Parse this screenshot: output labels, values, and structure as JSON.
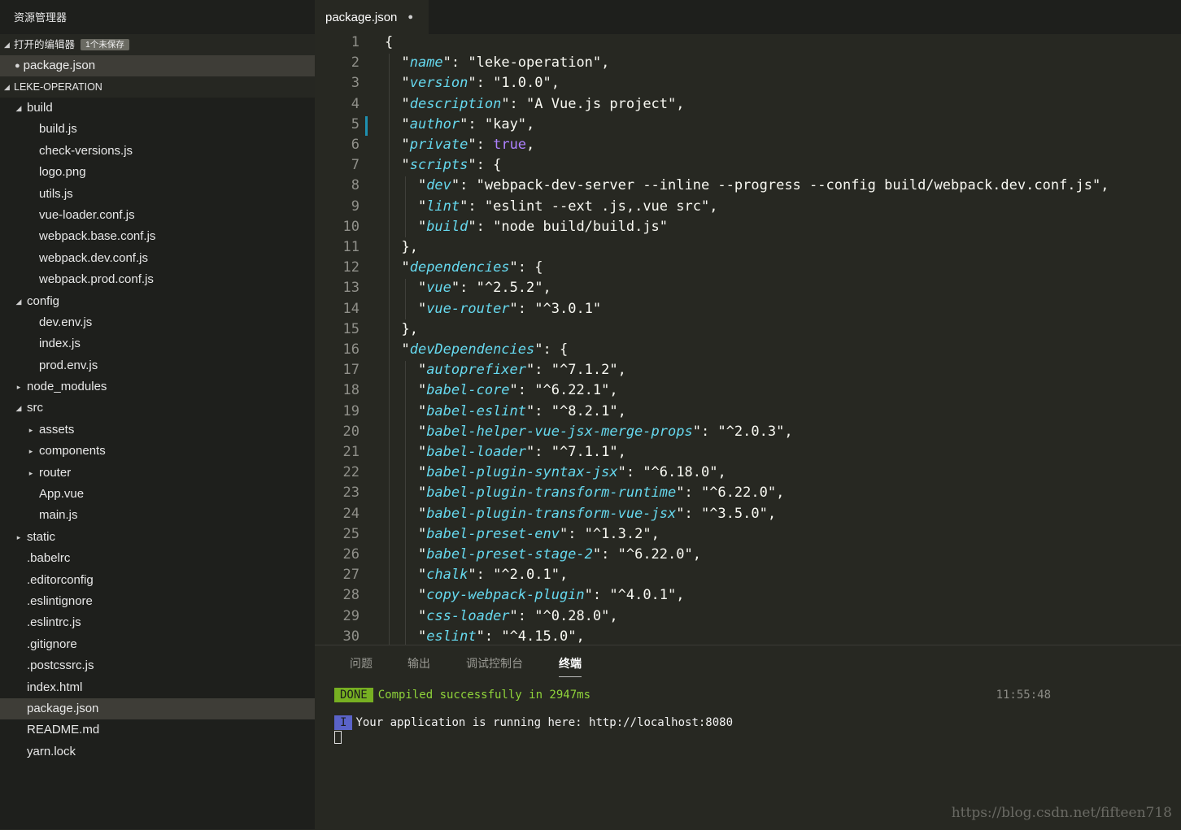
{
  "sidebar": {
    "title": "资源管理器",
    "open_editors": {
      "header": "打开的编辑器",
      "badge": "1个未保存",
      "items": [
        {
          "dirty": "●",
          "label": "package.json"
        }
      ]
    },
    "project": {
      "header": "LEKE-OPERATION",
      "tree": [
        {
          "label": "build",
          "depth": 0,
          "type": "folder-open",
          "twisty": "◢"
        },
        {
          "label": "build.js",
          "depth": 1,
          "type": "file"
        },
        {
          "label": "check-versions.js",
          "depth": 1,
          "type": "file"
        },
        {
          "label": "logo.png",
          "depth": 1,
          "type": "file"
        },
        {
          "label": "utils.js",
          "depth": 1,
          "type": "file"
        },
        {
          "label": "vue-loader.conf.js",
          "depth": 1,
          "type": "file"
        },
        {
          "label": "webpack.base.conf.js",
          "depth": 1,
          "type": "file"
        },
        {
          "label": "webpack.dev.conf.js",
          "depth": 1,
          "type": "file"
        },
        {
          "label": "webpack.prod.conf.js",
          "depth": 1,
          "type": "file"
        },
        {
          "label": "config",
          "depth": 0,
          "type": "folder-open",
          "twisty": "◢"
        },
        {
          "label": "dev.env.js",
          "depth": 1,
          "type": "file"
        },
        {
          "label": "index.js",
          "depth": 1,
          "type": "file"
        },
        {
          "label": "prod.env.js",
          "depth": 1,
          "type": "file"
        },
        {
          "label": "node_modules",
          "depth": 0,
          "type": "folder-closed",
          "twisty": "▸"
        },
        {
          "label": "src",
          "depth": 0,
          "type": "folder-open",
          "twisty": "◢"
        },
        {
          "label": "assets",
          "depth": 1,
          "type": "folder-closed",
          "twisty": "▸"
        },
        {
          "label": "components",
          "depth": 1,
          "type": "folder-closed",
          "twisty": "▸"
        },
        {
          "label": "router",
          "depth": 1,
          "type": "folder-closed",
          "twisty": "▸"
        },
        {
          "label": "App.vue",
          "depth": 1,
          "type": "file"
        },
        {
          "label": "main.js",
          "depth": 1,
          "type": "file"
        },
        {
          "label": "static",
          "depth": 0,
          "type": "folder-closed",
          "twisty": "▸"
        },
        {
          "label": ".babelrc",
          "depth": 0,
          "type": "file"
        },
        {
          "label": ".editorconfig",
          "depth": 0,
          "type": "file"
        },
        {
          "label": ".eslintignore",
          "depth": 0,
          "type": "file"
        },
        {
          "label": ".eslintrc.js",
          "depth": 0,
          "type": "file"
        },
        {
          "label": ".gitignore",
          "depth": 0,
          "type": "file"
        },
        {
          "label": ".postcssrc.js",
          "depth": 0,
          "type": "file"
        },
        {
          "label": "index.html",
          "depth": 0,
          "type": "file"
        },
        {
          "label": "package.json",
          "depth": 0,
          "type": "file",
          "selected": true
        },
        {
          "label": "README.md",
          "depth": 0,
          "type": "file"
        },
        {
          "label": "yarn.lock",
          "depth": 0,
          "type": "file"
        }
      ]
    }
  },
  "editor": {
    "tab": {
      "label": "package.json",
      "dirty": "●"
    },
    "lines": [
      [
        {
          "t": "p",
          "v": "{"
        }
      ],
      [
        {
          "t": "p",
          "v": "  \""
        },
        {
          "t": "k",
          "v": "name"
        },
        {
          "t": "p",
          "v": "\": "
        },
        {
          "t": "s",
          "v": "\"leke-operation\""
        },
        {
          "t": "p",
          "v": ","
        }
      ],
      [
        {
          "t": "p",
          "v": "  \""
        },
        {
          "t": "k",
          "v": "version"
        },
        {
          "t": "p",
          "v": "\": "
        },
        {
          "t": "s",
          "v": "\"1.0.0\""
        },
        {
          "t": "p",
          "v": ","
        }
      ],
      [
        {
          "t": "p",
          "v": "  \""
        },
        {
          "t": "k",
          "v": "description"
        },
        {
          "t": "p",
          "v": "\": "
        },
        {
          "t": "s",
          "v": "\"A Vue.js project\""
        },
        {
          "t": "p",
          "v": ","
        }
      ],
      [
        {
          "t": "p",
          "v": "  \""
        },
        {
          "t": "k",
          "v": "author"
        },
        {
          "t": "p",
          "v": "\": "
        },
        {
          "t": "s",
          "v": "\"kay\""
        },
        {
          "t": "p",
          "v": ","
        }
      ],
      [
        {
          "t": "p",
          "v": "  \""
        },
        {
          "t": "k",
          "v": "private"
        },
        {
          "t": "p",
          "v": "\": "
        },
        {
          "t": "b",
          "v": "true"
        },
        {
          "t": "p",
          "v": ","
        }
      ],
      [
        {
          "t": "p",
          "v": "  \""
        },
        {
          "t": "k",
          "v": "scripts"
        },
        {
          "t": "p",
          "v": "\": {"
        }
      ],
      [
        {
          "t": "p",
          "v": "    \""
        },
        {
          "t": "k",
          "v": "dev"
        },
        {
          "t": "p",
          "v": "\": "
        },
        {
          "t": "s",
          "v": "\"webpack-dev-server --inline --progress --config build/webpack.dev.conf.js\""
        },
        {
          "t": "p",
          "v": ","
        }
      ],
      [
        {
          "t": "p",
          "v": "    \""
        },
        {
          "t": "k",
          "v": "lint"
        },
        {
          "t": "p",
          "v": "\": "
        },
        {
          "t": "s",
          "v": "\"eslint --ext .js,.vue src\""
        },
        {
          "t": "p",
          "v": ","
        }
      ],
      [
        {
          "t": "p",
          "v": "    \""
        },
        {
          "t": "k",
          "v": "build"
        },
        {
          "t": "p",
          "v": "\": "
        },
        {
          "t": "s",
          "v": "\"node build/build.js\""
        }
      ],
      [
        {
          "t": "p",
          "v": "  },"
        }
      ],
      [
        {
          "t": "p",
          "v": "  \""
        },
        {
          "t": "k",
          "v": "dependencies"
        },
        {
          "t": "p",
          "v": "\": {"
        }
      ],
      [
        {
          "t": "p",
          "v": "    \""
        },
        {
          "t": "k",
          "v": "vue"
        },
        {
          "t": "p",
          "v": "\": "
        },
        {
          "t": "s",
          "v": "\"^2.5.2\""
        },
        {
          "t": "p",
          "v": ","
        }
      ],
      [
        {
          "t": "p",
          "v": "    \""
        },
        {
          "t": "k",
          "v": "vue-router"
        },
        {
          "t": "p",
          "v": "\": "
        },
        {
          "t": "s",
          "v": "\"^3.0.1\""
        }
      ],
      [
        {
          "t": "p",
          "v": "  },"
        }
      ],
      [
        {
          "t": "p",
          "v": "  \""
        },
        {
          "t": "k",
          "v": "devDependencies"
        },
        {
          "t": "p",
          "v": "\": {"
        }
      ],
      [
        {
          "t": "p",
          "v": "    \""
        },
        {
          "t": "k",
          "v": "autoprefixer"
        },
        {
          "t": "p",
          "v": "\": "
        },
        {
          "t": "s",
          "v": "\"^7.1.2\""
        },
        {
          "t": "p",
          "v": ","
        }
      ],
      [
        {
          "t": "p",
          "v": "    \""
        },
        {
          "t": "k",
          "v": "babel-core"
        },
        {
          "t": "p",
          "v": "\": "
        },
        {
          "t": "s",
          "v": "\"^6.22.1\""
        },
        {
          "t": "p",
          "v": ","
        }
      ],
      [
        {
          "t": "p",
          "v": "    \""
        },
        {
          "t": "k",
          "v": "babel-eslint"
        },
        {
          "t": "p",
          "v": "\": "
        },
        {
          "t": "s",
          "v": "\"^8.2.1\""
        },
        {
          "t": "p",
          "v": ","
        }
      ],
      [
        {
          "t": "p",
          "v": "    \""
        },
        {
          "t": "k",
          "v": "babel-helper-vue-jsx-merge-props"
        },
        {
          "t": "p",
          "v": "\": "
        },
        {
          "t": "s",
          "v": "\"^2.0.3\""
        },
        {
          "t": "p",
          "v": ","
        }
      ],
      [
        {
          "t": "p",
          "v": "    \""
        },
        {
          "t": "k",
          "v": "babel-loader"
        },
        {
          "t": "p",
          "v": "\": "
        },
        {
          "t": "s",
          "v": "\"^7.1.1\""
        },
        {
          "t": "p",
          "v": ","
        }
      ],
      [
        {
          "t": "p",
          "v": "    \""
        },
        {
          "t": "k",
          "v": "babel-plugin-syntax-jsx"
        },
        {
          "t": "p",
          "v": "\": "
        },
        {
          "t": "s",
          "v": "\"^6.18.0\""
        },
        {
          "t": "p",
          "v": ","
        }
      ],
      [
        {
          "t": "p",
          "v": "    \""
        },
        {
          "t": "k",
          "v": "babel-plugin-transform-runtime"
        },
        {
          "t": "p",
          "v": "\": "
        },
        {
          "t": "s",
          "v": "\"^6.22.0\""
        },
        {
          "t": "p",
          "v": ","
        }
      ],
      [
        {
          "t": "p",
          "v": "    \""
        },
        {
          "t": "k",
          "v": "babel-plugin-transform-vue-jsx"
        },
        {
          "t": "p",
          "v": "\": "
        },
        {
          "t": "s",
          "v": "\"^3.5.0\""
        },
        {
          "t": "p",
          "v": ","
        }
      ],
      [
        {
          "t": "p",
          "v": "    \""
        },
        {
          "t": "k",
          "v": "babel-preset-env"
        },
        {
          "t": "p",
          "v": "\": "
        },
        {
          "t": "s",
          "v": "\"^1.3.2\""
        },
        {
          "t": "p",
          "v": ","
        }
      ],
      [
        {
          "t": "p",
          "v": "    \""
        },
        {
          "t": "k",
          "v": "babel-preset-stage-2"
        },
        {
          "t": "p",
          "v": "\": "
        },
        {
          "t": "s",
          "v": "\"^6.22.0\""
        },
        {
          "t": "p",
          "v": ","
        }
      ],
      [
        {
          "t": "p",
          "v": "    \""
        },
        {
          "t": "k",
          "v": "chalk"
        },
        {
          "t": "p",
          "v": "\": "
        },
        {
          "t": "s",
          "v": "\"^2.0.1\""
        },
        {
          "t": "p",
          "v": ","
        }
      ],
      [
        {
          "t": "p",
          "v": "    \""
        },
        {
          "t": "k",
          "v": "copy-webpack-plugin"
        },
        {
          "t": "p",
          "v": "\": "
        },
        {
          "t": "s",
          "v": "\"^4.0.1\""
        },
        {
          "t": "p",
          "v": ","
        }
      ],
      [
        {
          "t": "p",
          "v": "    \""
        },
        {
          "t": "k",
          "v": "css-loader"
        },
        {
          "t": "p",
          "v": "\": "
        },
        {
          "t": "s",
          "v": "\"^0.28.0\""
        },
        {
          "t": "p",
          "v": ","
        }
      ],
      [
        {
          "t": "p",
          "v": "    \""
        },
        {
          "t": "k",
          "v": "eslint"
        },
        {
          "t": "p",
          "v": "\": "
        },
        {
          "t": "s",
          "v": "\"^4.15.0\""
        },
        {
          "t": "p",
          "v": ","
        }
      ]
    ]
  },
  "panel": {
    "tabs": [
      {
        "label": "问题",
        "active": false
      },
      {
        "label": "输出",
        "active": false
      },
      {
        "label": "调试控制台",
        "active": false
      },
      {
        "label": "终端",
        "active": true
      }
    ],
    "terminal": {
      "done_badge": "DONE",
      "done_text": "Compiled successfully in 2947ms",
      "time": "11:55:48",
      "info_badge": "I",
      "info_text": "Your application is running here: http://localhost:8080"
    }
  },
  "watermark": "https://blog.csdn.net/fifteen718",
  "colors": {
    "accent_key": "#66d9ef",
    "boolean": "#ae81ff",
    "done": "#77b022",
    "info": "#5a63c9"
  }
}
